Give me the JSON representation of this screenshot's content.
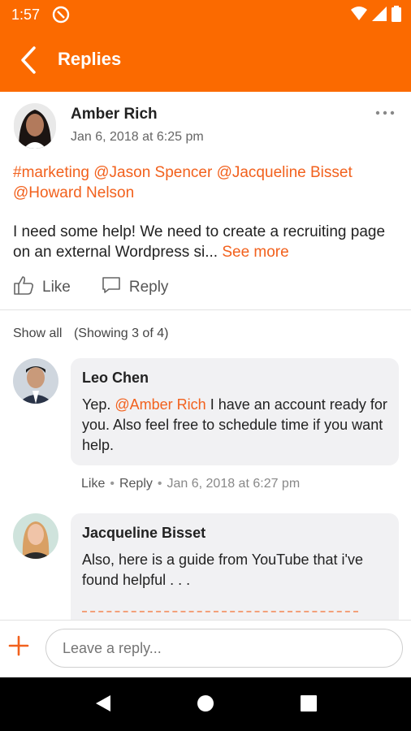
{
  "status_bar": {
    "time": "1:57"
  },
  "app_bar": {
    "title": "Replies"
  },
  "post": {
    "author": "Amber Rich",
    "date": "Jan 6, 2018 at 6:25 pm",
    "tags": "#marketing @Jason Spencer @Jacqueline Bisset @Howard Nelson",
    "body": "I need some help! We need to create a recruiting page on an external Wordpress si...",
    "see_more": "See more",
    "like_label": "Like",
    "reply_label": "Reply"
  },
  "replies_header": {
    "show_all": "Show all",
    "showing": "(Showing 3 of 4)"
  },
  "replies": [
    {
      "author": "Leo Chen",
      "text_pre": "Yep. ",
      "mention": "@Amber Rich",
      "text_post": " I have an account ready for you.  Also feel free to schedule time if you want help.",
      "like": "Like",
      "reply": "Reply",
      "timestamp": "Jan 6, 2018 at 6:27 pm"
    },
    {
      "author": "Jacqueline Bisset",
      "text": "Also, here is a guide from YouTube that i've found helpful . . ."
    }
  ],
  "composer": {
    "placeholder": "Leave a reply..."
  },
  "colors": {
    "accent": "#fb6a00",
    "link": "#f2611d",
    "bubble": "#f1f1f3"
  }
}
